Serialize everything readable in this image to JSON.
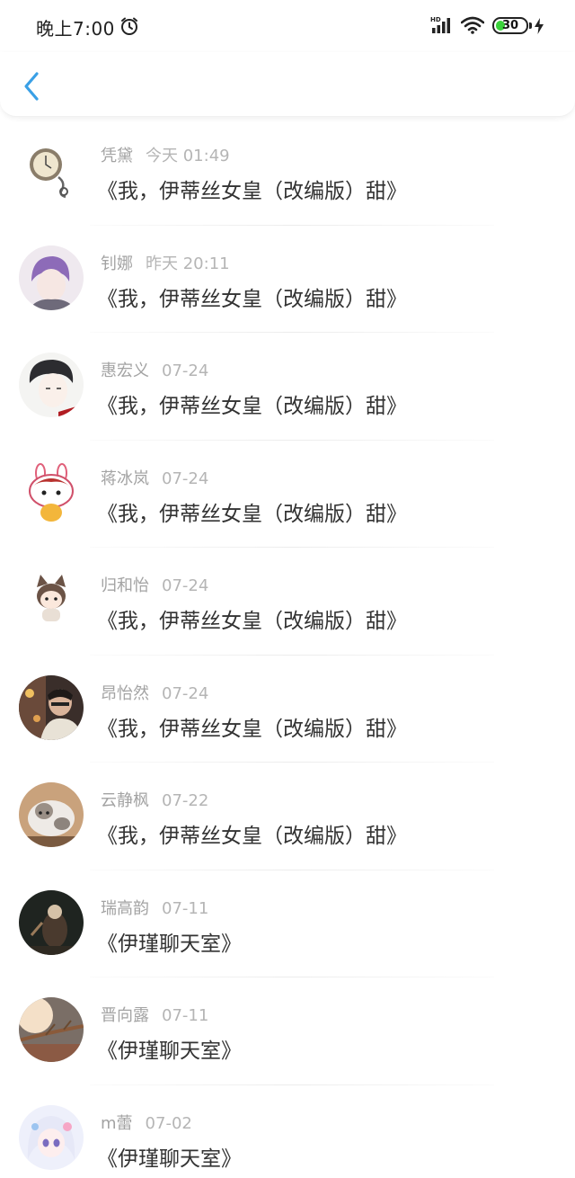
{
  "status_bar": {
    "time": "晚上7:00",
    "battery_level": "30",
    "battery_percent": 30,
    "signal_label": "HD"
  },
  "nav": {
    "back_icon": "chevron-left-icon",
    "accent_color": "#3aa0e6"
  },
  "messages": [
    {
      "name": "凭黛",
      "time": "今天 01:49",
      "title": "《我，伊蒂丝女皇（改编版）甜》",
      "avatar": "pocket-watch"
    },
    {
      "name": "钊娜",
      "time": "昨天 20:11",
      "title": "《我，伊蒂丝女皇（改编版）甜》",
      "avatar": "anime-boy-purple"
    },
    {
      "name": "惠宏义",
      "time": "07-24",
      "title": "《我，伊蒂丝女皇（改编版）甜》",
      "avatar": "anime-boy-sketch"
    },
    {
      "name": "蒋冰岚",
      "time": "07-24",
      "title": "《我，伊蒂丝女皇（改编版）甜》",
      "avatar": "bunny-cartoon"
    },
    {
      "name": "归和怡",
      "time": "07-24",
      "title": "《我，伊蒂丝女皇（改编版）甜》",
      "avatar": "cat-ear-chibi"
    },
    {
      "name": "昂怡然",
      "time": "07-24",
      "title": "《我，伊蒂丝女皇（改编版）甜》",
      "avatar": "man-photo"
    },
    {
      "name": "云静枫",
      "time": "07-22",
      "title": "《我，伊蒂丝女皇（改编版）甜》",
      "avatar": "cat-photo"
    },
    {
      "name": "瑞高韵",
      "time": "07-11",
      "title": "《伊瑾聊天室》",
      "avatar": "dark-scene"
    },
    {
      "name": "晋向露",
      "time": "07-11",
      "title": "《伊瑾聊天室》",
      "avatar": "sunset-branch"
    },
    {
      "name": "m蕾",
      "time": "07-02",
      "title": "《伊瑾聊天室》",
      "avatar": "anime-girl-white"
    }
  ]
}
